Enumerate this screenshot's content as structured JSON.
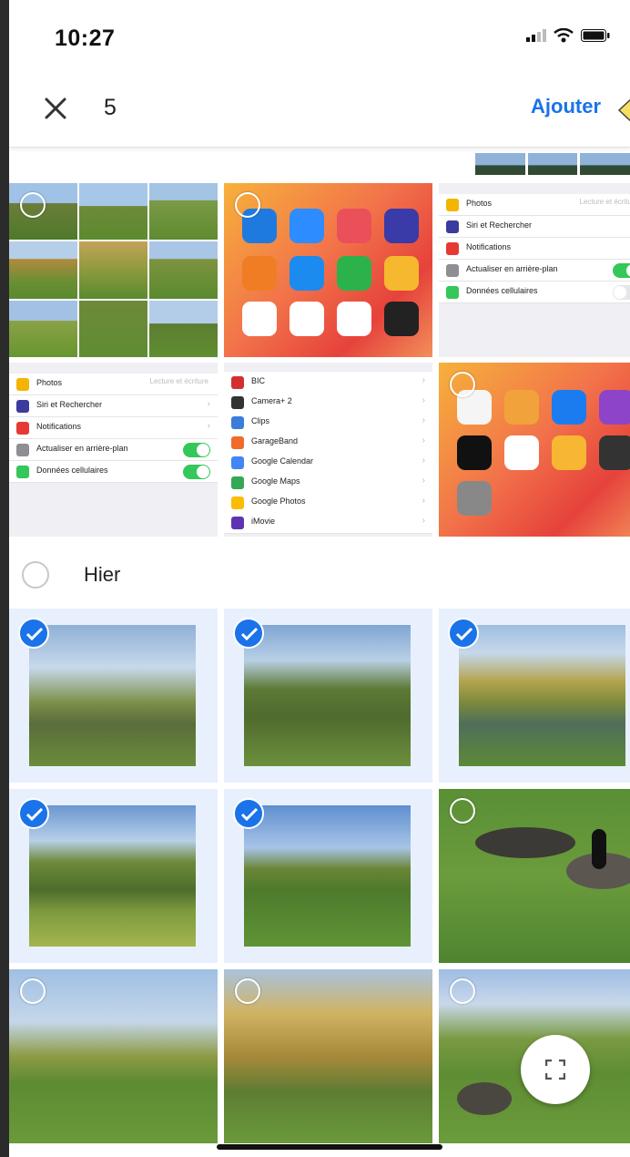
{
  "status_bar": {
    "time": "10:27"
  },
  "toolbar": {
    "selected_count": "5",
    "add_label": "Ajouter"
  },
  "section": {
    "title": "Hier"
  },
  "settings_a": {
    "rows": [
      {
        "label": "Photos",
        "meta": "Lecture et écriture"
      },
      {
        "label": "Siri et Rechercher"
      },
      {
        "label": "Notifications"
      },
      {
        "label": "Actualiser en arrière-plan"
      },
      {
        "label": "Données cellulaires"
      }
    ]
  },
  "settings_b": {
    "rows": [
      {
        "label": "Photos",
        "meta": "Lecture et écriture"
      },
      {
        "label": "Siri et Rechercher"
      },
      {
        "label": "Notifications"
      },
      {
        "label": "Actualiser en arrière-plan"
      },
      {
        "label": "Données cellulaires"
      }
    ]
  },
  "app_list": {
    "rows": [
      {
        "label": "BIC"
      },
      {
        "label": "Camera+ 2"
      },
      {
        "label": "Clips"
      },
      {
        "label": "GarageBand"
      },
      {
        "label": "Google Calendar"
      },
      {
        "label": "Google Maps"
      },
      {
        "label": "Google Photos"
      },
      {
        "label": "iMovie"
      }
    ]
  },
  "colors": {
    "accent": "#1a73e8",
    "selection_bg": "#e8f0fe",
    "toggle_on": "#34c759"
  },
  "icons": [
    "close-icon",
    "checkmark-icon",
    "fullscreen-icon",
    "signal-icon",
    "wifi-icon",
    "battery-icon"
  ]
}
